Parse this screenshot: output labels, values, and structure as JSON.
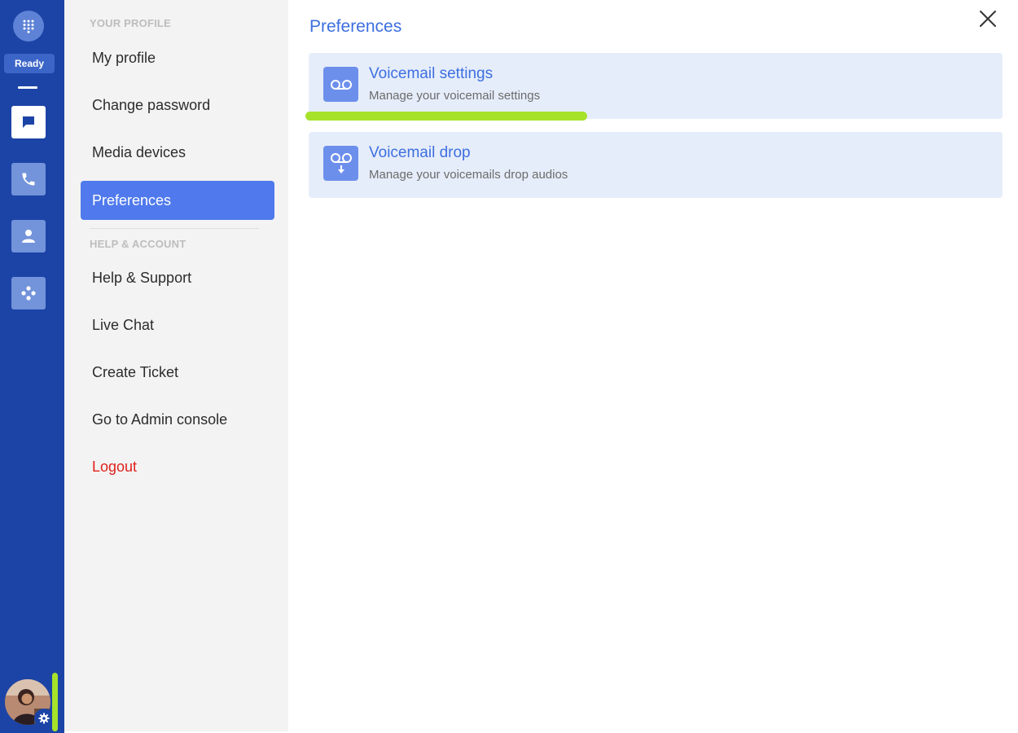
{
  "rail": {
    "status": "Ready",
    "nav": [
      {
        "icon": "chat-icon",
        "active": true
      },
      {
        "icon": "phone-icon",
        "active": false
      },
      {
        "icon": "contact-icon",
        "active": false
      },
      {
        "icon": "integrations-icon",
        "active": false
      }
    ]
  },
  "menu": {
    "section_profile": "YOUR PROFILE",
    "section_help": "HELP & ACCOUNT",
    "items": {
      "my_profile": "My profile",
      "change_password": "Change password",
      "media_devices": "Media devices",
      "preferences": "Preferences",
      "help_support": "Help & Support",
      "live_chat": "Live Chat",
      "create_ticket": "Create Ticket",
      "admin_console": "Go to Admin console",
      "logout": "Logout"
    },
    "active": "Preferences"
  },
  "main": {
    "title": "Preferences",
    "cards": [
      {
        "title": "Voicemail settings",
        "subtitle": "Manage your voicemail settings",
        "icon": "voicemail-icon"
      },
      {
        "title": "Voicemail drop",
        "subtitle": "Manage your voicemails drop audios",
        "icon": "voicemail-drop-icon"
      }
    ]
  },
  "colors": {
    "rail_bg": "#1c44a6",
    "accent": "#4f79ec",
    "title_blue": "#3d6fe0",
    "highlight": "#a6e22a",
    "logout_red": "#e0211b"
  }
}
